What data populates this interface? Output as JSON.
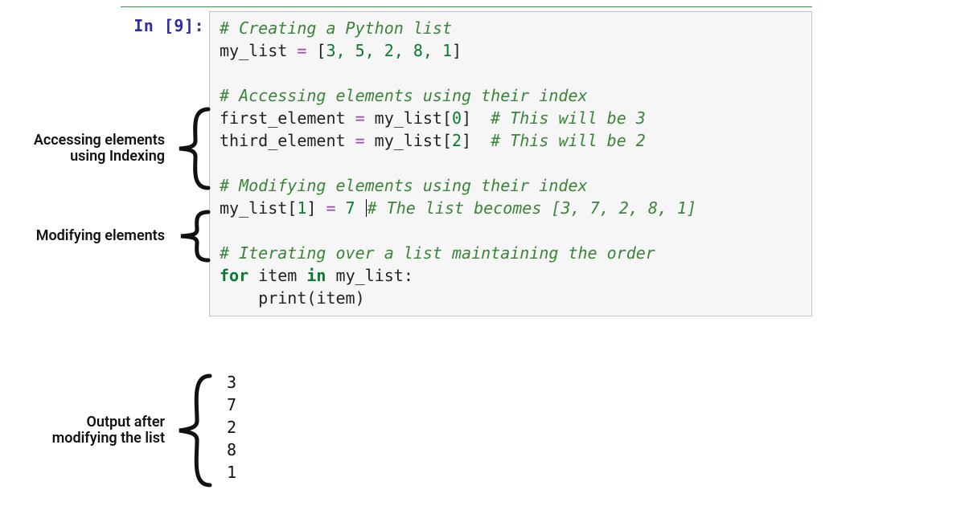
{
  "prompt": "In [9]:",
  "code": {
    "l1": {
      "comment": "# Creating a Python list"
    },
    "l2": {
      "lhs": "my_list",
      "eq": " = ",
      "rhs_open": "[",
      "vals": "3, 5, 2, 8, 1",
      "rhs_close": "]"
    },
    "l3": {
      "comment": "# Accessing elements using their index"
    },
    "l4": {
      "lhs": "first_element",
      "eq": " = ",
      "rhs": "my_list[",
      "idx": "0",
      "close": "]  ",
      "tail_cm": "# This will be 3"
    },
    "l5": {
      "lhs": "third_element",
      "eq": " = ",
      "rhs": "my_list[",
      "idx": "2",
      "close": "]  ",
      "tail_cm": "# This will be 2"
    },
    "l6": {
      "comment": "# Modifying elements using their index"
    },
    "l7": {
      "lhs": "my_list[",
      "idx": "1",
      "mid": "]",
      "eq": " = ",
      "val": "7",
      "sp": " ",
      "tail_cm": "# The list becomes [3, 7, 2, 8, 1]"
    },
    "l8": {
      "comment": "# Iterating over a list maintaining the order"
    },
    "l9": {
      "kw_for": "for",
      "sp1": " ",
      "var": "item",
      "sp2": " ",
      "kw_in": "in",
      "sp3": " ",
      "iter": "my_list",
      "colon": ":"
    },
    "l10": {
      "indent": "    ",
      "fn": "print",
      "open": "(",
      "arg": "item",
      "close": ")"
    }
  },
  "output": {
    "lines": [
      "3",
      "7",
      "2",
      "8",
      "1"
    ]
  },
  "annotations": {
    "a1": "Accessing elements\nusing Indexing",
    "a2": "Modifying elements",
    "a3": "Output after\nmodifying the list"
  }
}
